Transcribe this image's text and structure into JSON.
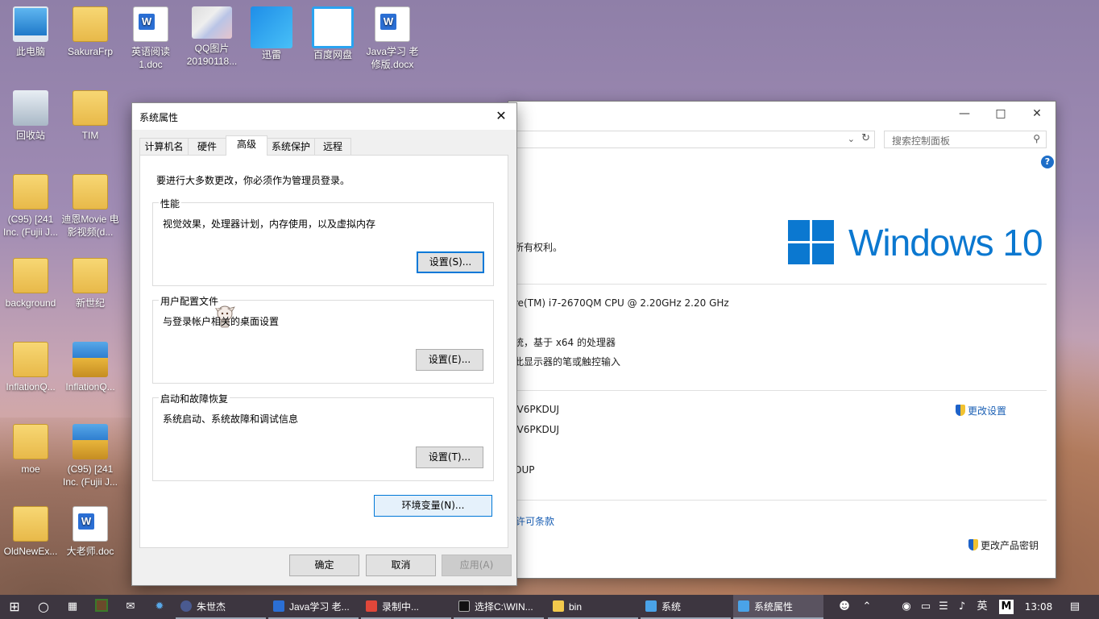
{
  "desktop": {
    "icons": [
      {
        "label": "此电脑",
        "icon": "pc-icon"
      },
      {
        "label": "SakuraFrp",
        "icon": "folder-icon"
      },
      {
        "label": "英语阅读1.doc",
        "icon": "word-doc-icon"
      },
      {
        "label": "QQ图片20190118...",
        "icon": "image-icon"
      },
      {
        "label": "迅雷",
        "icon": "xunlei-icon"
      },
      {
        "label": "百度网盘",
        "icon": "baidu-netdisk-icon"
      },
      {
        "label": "Java学习 老 修版.docx",
        "icon": "word-doc-icon"
      },
      {
        "label": "回收站",
        "icon": "recycle-bin-icon"
      },
      {
        "label": "TIM",
        "icon": "folder-icon"
      },
      {
        "label": "(C95) [241 Inc. (Fujii J...",
        "icon": "folder-icon"
      },
      {
        "label": "迪恩Movie 电影视频(d...",
        "icon": "folder-icon"
      },
      {
        "label": "background",
        "icon": "folder-icon"
      },
      {
        "label": "新世纪",
        "icon": "folder-icon"
      },
      {
        "label": "InflationQ...",
        "icon": "folder-icon"
      },
      {
        "label": "InflationQ...",
        "icon": "zip-icon"
      },
      {
        "label": "moe",
        "icon": "folder-icon"
      },
      {
        "label": "(C95) [241 Inc. (Fujii J...",
        "icon": "zip-icon"
      },
      {
        "label": "OldNewEx...",
        "icon": "folder-icon"
      },
      {
        "label": "大老师.doc",
        "icon": "word-doc-icon"
      }
    ]
  },
  "control_panel": {
    "search_placeholder": "搜索控制面板",
    "copyright_tail": "所有权利。",
    "windows_brand": "Windows 10",
    "cpu_line": "re(TM) i7-2670QM CPU @ 2.20GHz   2.20 GHz",
    "system_type": "统，基于 x64 的处理器",
    "pen_touch": "此显示器的笔或触控输入",
    "computer_name": "JV6PKDUJ",
    "full_name": "JV6PKDUJ",
    "workgroup": "OUP",
    "change_settings": "更改设置",
    "license_terms": "许可条款",
    "change_product_key": "更改产品密钥"
  },
  "dialog": {
    "title": "系统属性",
    "tabs": [
      "计算机名",
      "硬件",
      "高级",
      "系统保护",
      "远程"
    ],
    "active_tab": "高级",
    "admin_note": "要进行大多数更改，你必须作为管理员登录。",
    "performance": {
      "label": "性能",
      "desc": "视觉效果，处理器计划，内存使用，以及虚拟内存",
      "button": "设置(S)..."
    },
    "user_profiles": {
      "label": "用户配置文件",
      "desc": "与登录帐户相关的桌面设置",
      "button": "设置(E)..."
    },
    "startup_recovery": {
      "label": "启动和故障恢复",
      "desc": "系统启动、系统故障和调试信息",
      "button": "设置(T)..."
    },
    "env_button": "环境变量(N)...",
    "ok": "确定",
    "cancel": "取消",
    "apply": "应用(A)"
  },
  "taskbar": {
    "items": [
      {
        "label": "朱世杰",
        "icon": "qq-avatar-icon"
      },
      {
        "label": "Java学习 老...",
        "icon": "word-icon"
      },
      {
        "label": "录制中...",
        "icon": "recorder-icon"
      },
      {
        "label": "选择C:\\WIN...",
        "icon": "cmd-icon"
      },
      {
        "label": "bin",
        "icon": "folder-icon"
      },
      {
        "label": "系统",
        "icon": "system-icon"
      },
      {
        "label": "系统属性",
        "icon": "system-props-icon"
      }
    ],
    "ime": "英",
    "ime_mode": "M",
    "clock": "13:08"
  }
}
